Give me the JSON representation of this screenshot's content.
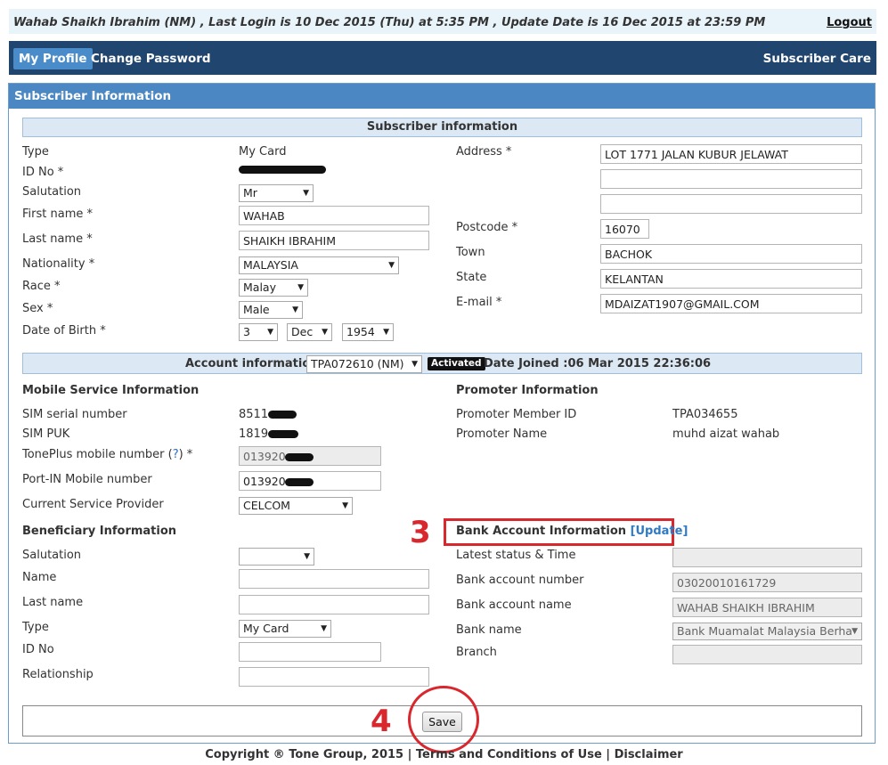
{
  "header": {
    "login_info": "Wahab Shaikh Ibrahim (NM) , Last Login is 10 Dec 2015 (Thu) at 5:35 PM , Update Date is 16 Dec 2015 at 23:59 PM",
    "logout": "Logout"
  },
  "nav": {
    "my_profile": "My Profile",
    "change_password": "Change Password",
    "subscriber_care": "Subscriber Care"
  },
  "panel_title": "Subscriber Information",
  "subscriber": {
    "section_title": "Subscriber information",
    "type_label": "Type",
    "type_value": "My Card",
    "id_label": "ID No *",
    "salutation_label": "Salutation",
    "salutation_value": "Mr",
    "first_name_label": "First name *",
    "first_name_value": "WAHAB",
    "last_name_label": "Last name *",
    "last_name_value": "SHAIKH IBRAHIM",
    "nationality_label": "Nationality *",
    "nationality_value": "MALAYSIA",
    "race_label": "Race *",
    "race_value": "Malay",
    "sex_label": "Sex *",
    "sex_value": "Male",
    "dob_label": "Date of Birth *",
    "dob_day": "3",
    "dob_month": "Dec",
    "dob_year": "1954",
    "address_label": "Address *",
    "address_line1": "LOT 1771 JALAN KUBUR JELAWAT",
    "address_line2": "",
    "address_line3": "",
    "postcode_label": "Postcode *",
    "postcode_value": "16070",
    "town_label": "Town",
    "town_value": "BACHOK",
    "state_label": "State",
    "state_value": "KELANTAN",
    "email_label": "E-mail *",
    "email_value": "MDAIZAT1907@GMAIL.COM"
  },
  "account": {
    "label": "Account information",
    "account_value": "TPA072610 (NM)",
    "status": "Activated",
    "date_joined": "Date Joined :06 Mar 2015 22:36:06"
  },
  "mobile": {
    "title": "Mobile Service Information",
    "sim_serial_label": "SIM serial number",
    "sim_serial_value": "8511",
    "sim_puk_label": "SIM PUK",
    "sim_puk_value": "1819",
    "toneplus_label": "TonePlus mobile number (",
    "toneplus_help": "?",
    "toneplus_label_end": ") *",
    "toneplus_value": "013920",
    "portin_label": "Port-IN Mobile number",
    "portin_value": "013920",
    "provider_label": "Current Service Provider",
    "provider_value": "CELCOM"
  },
  "promoter": {
    "title": "Promoter Information",
    "member_id_label": "Promoter Member ID",
    "member_id_value": "TPA034655",
    "name_label": "Promoter Name",
    "name_value": "muhd aizat wahab"
  },
  "beneficiary": {
    "title": "Beneficiary Information",
    "salutation_label": "Salutation",
    "salutation_value": "",
    "name_label": "Name",
    "name_value": "",
    "last_name_label": "Last name",
    "last_name_value": "",
    "type_label": "Type",
    "type_value": "My Card",
    "id_label": "ID No",
    "id_value": "",
    "relationship_label": "Relationship",
    "relationship_value": ""
  },
  "bank": {
    "title": "Bank Account Information",
    "update_link": "[Update]",
    "status_label": "Latest status & Time",
    "status_value": "",
    "account_number_label": "Bank account number",
    "account_number_value": "03020010161729",
    "account_name_label": "Bank account name",
    "account_name_value": "WAHAB SHAIKH IBRAHIM",
    "bank_name_label": "Bank name",
    "bank_name_value": "Bank Muamalat Malaysia Berha",
    "branch_label": "Branch",
    "branch_value": ""
  },
  "annotations": {
    "step3": "3",
    "step4": "4",
    "color": "#d9272e"
  },
  "save_label": "Save",
  "footer": "Copyright ® Tone Group, 2015 | Terms and Conditions of Use | Disclaimer",
  "colors": {
    "nav_bg": "#20456e",
    "panel_header": "#4b87c3",
    "active_tab": "#4a8bc9",
    "link": "#2f7ac4"
  }
}
